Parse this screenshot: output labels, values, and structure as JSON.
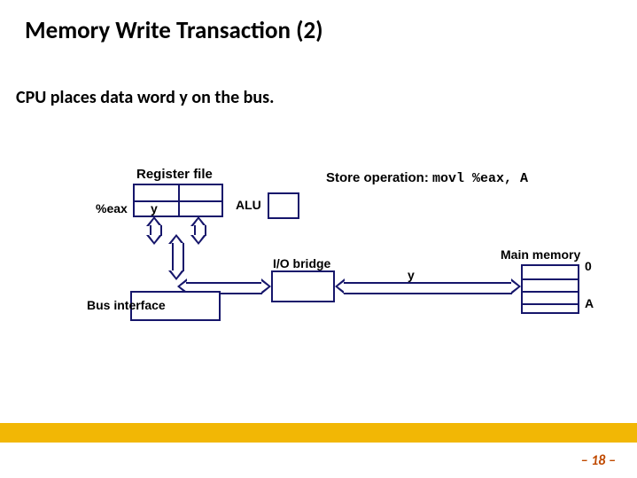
{
  "title": "Memory Write Transaction (2)",
  "subtitle": "CPU places data word y on the bus.",
  "labels": {
    "regfile": "Register file",
    "eax": "%eax",
    "eax_val": "y",
    "alu": "ALU",
    "storeop_prefix": "Store operation:",
    "storeop_code": "movl %eax, A",
    "io_bridge": "I/O bridge",
    "bus_val": "y",
    "bus_iface": "Bus interface",
    "main_mem": "Main memory",
    "mem0": "0",
    "memA": "A"
  },
  "page_num": "– 18 –"
}
